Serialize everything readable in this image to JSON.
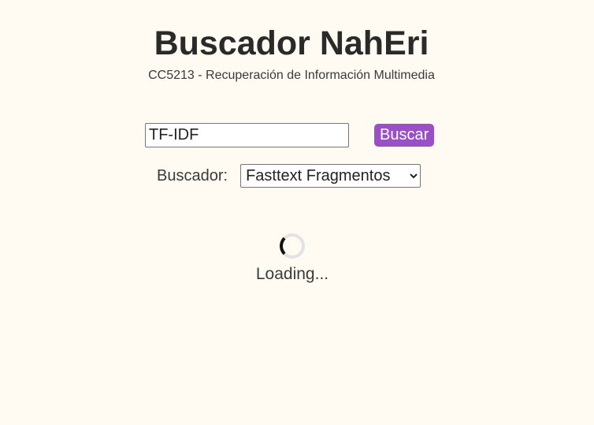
{
  "header": {
    "title": "Buscador NahEri",
    "subtitle": "CC5213 - Recuperación de Información Multimedia"
  },
  "search": {
    "value": "TF-IDF",
    "button_label": "Buscar"
  },
  "engine": {
    "label": "Buscador:",
    "selected": "Fasttext Fragmentos"
  },
  "status": {
    "loading_text": "Loading..."
  },
  "colors": {
    "background": "#fffbf3",
    "accent": "#9a4fc9"
  }
}
